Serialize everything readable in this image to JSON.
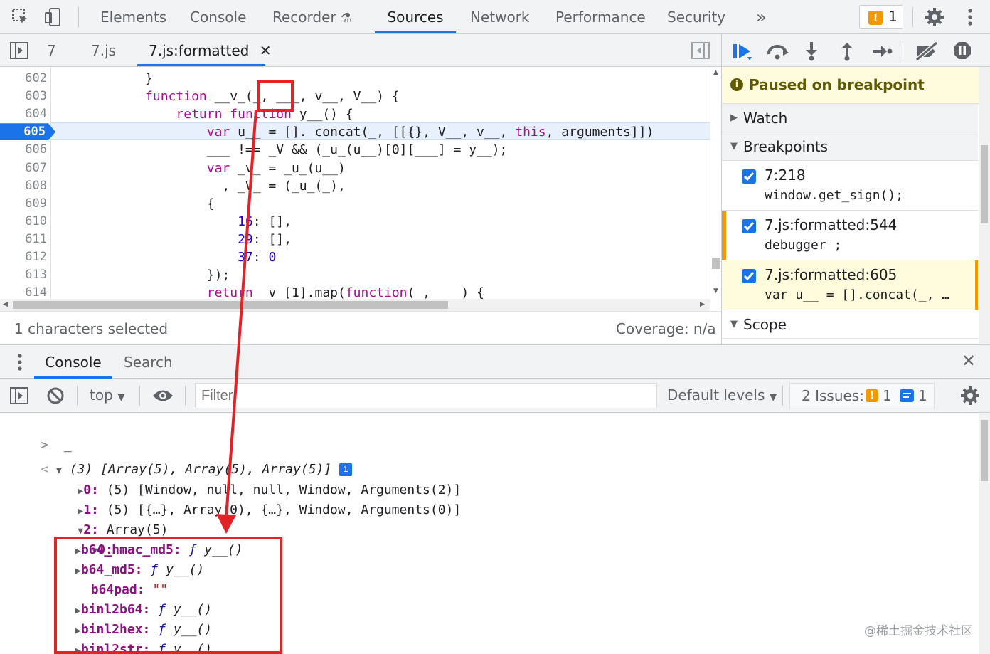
{
  "top_tabs": [
    "Elements",
    "Console",
    "Recorder",
    "Sources",
    "Network",
    "Performance",
    "Security"
  ],
  "active_top_tab": "Sources",
  "more_tabs_glyph": "»",
  "issues_count_top": "1",
  "file_tabs": [
    "7",
    "7.js",
    "7.js:formatted"
  ],
  "active_file_tab": "7.js:formatted",
  "close_glyph": "✕",
  "editor": {
    "lines": [
      {
        "n": "602",
        "html_plain": "            }"
      },
      {
        "n": "603",
        "kw": "function",
        "rest": " __v_(_, ___, v__, V__) {",
        "indent": "            "
      },
      {
        "n": "604",
        "kw": "return",
        "indent": "                ",
        "kw2": "function",
        "rest": " y__() {"
      },
      {
        "n": "605",
        "indent": "                    ",
        "kw": "var",
        "rest": " u__ = []. concat(_, [[{}, V__, v__, ",
        "kw2": "this",
        "rest2": ", arguments]])"
      },
      {
        "n": "606",
        "html_plain": "                    ___ !== _V && (_u_(u__)[0][___] = y__);"
      },
      {
        "n": "607",
        "indent": "                    ",
        "kw": "var",
        "rest": " _v_ = _u_(u__)"
      },
      {
        "n": "608",
        "html_plain": "                      , _V_ = (_u_(_),"
      },
      {
        "n": "609",
        "html_plain": "                    {"
      },
      {
        "n": "610",
        "indent": "                        ",
        "num": "16",
        "rest": ": [],"
      },
      {
        "n": "611",
        "indent": "                        ",
        "num": "29",
        "rest": ": [],"
      },
      {
        "n": "612",
        "indent": "                        ",
        "num": "37",
        "rest": ": ",
        "num2": "0"
      },
      {
        "n": "613",
        "html_plain": "                    });"
      },
      {
        "n": "614",
        "indent": "                    ",
        "kw": "return",
        "rest": " _v_[1].map(",
        "kw2": "function",
        "rest2": "(_, ___) {"
      }
    ],
    "current_line": "605"
  },
  "status": {
    "selection": "1 characters selected",
    "coverage": "Coverage: n/a"
  },
  "debugger": {
    "paused": "Paused on breakpoint",
    "watch": "Watch",
    "breakpoints": "Breakpoints",
    "scope": "Scope",
    "bp_items": [
      {
        "name": "7:218",
        "code": "window.get_sign();"
      },
      {
        "name": "7.js:formatted:544",
        "code": "debugger ;"
      },
      {
        "name": "7.js:formatted:605",
        "code": "var u__ = [].concat(_, …"
      }
    ]
  },
  "drawer": {
    "tabs": [
      "Console",
      "Search"
    ],
    "active": "Console"
  },
  "console_toolbar": {
    "context": "top",
    "filter_placeholder": "Filter",
    "levels": "Default levels",
    "issues_label": "2 Issues:",
    "warn_count": "1",
    "info_count": "1"
  },
  "console": {
    "prompt": ">",
    "input": "_",
    "result_prefix": "(3)",
    "result_summary": " [Array(5), Array(5), Array(5)]",
    "row0_key": "0",
    "row0_val": " (5) [Window, null, null, Window, Arguments(2)]",
    "row1_key": "1",
    "row1_val": " (5) [{…}, Array(0), {…}, Window, Arguments(0)]",
    "row2_key": "2",
    "row2_val": " Array(5)",
    "row20_key": "0",
    "props": [
      {
        "k": "b64_hmac_md5",
        "v": "y__()",
        "fn": true
      },
      {
        "k": "b64_md5",
        "v": "y__()",
        "fn": true
      },
      {
        "k": "b64pad",
        "v": "\"\"",
        "fn": false
      },
      {
        "k": "binl2b64",
        "v": "y__()",
        "fn": true
      },
      {
        "k": "binl2hex",
        "v": "y__()",
        "fn": true
      },
      {
        "k": "binl2str",
        "v": "y__()",
        "fn": true
      }
    ]
  },
  "watermark": "@稀土掘金技术社区",
  "colors": {
    "accent": "#1a73e8",
    "annotation_red": "#e32227",
    "paused_bg": "#fffbdd"
  }
}
